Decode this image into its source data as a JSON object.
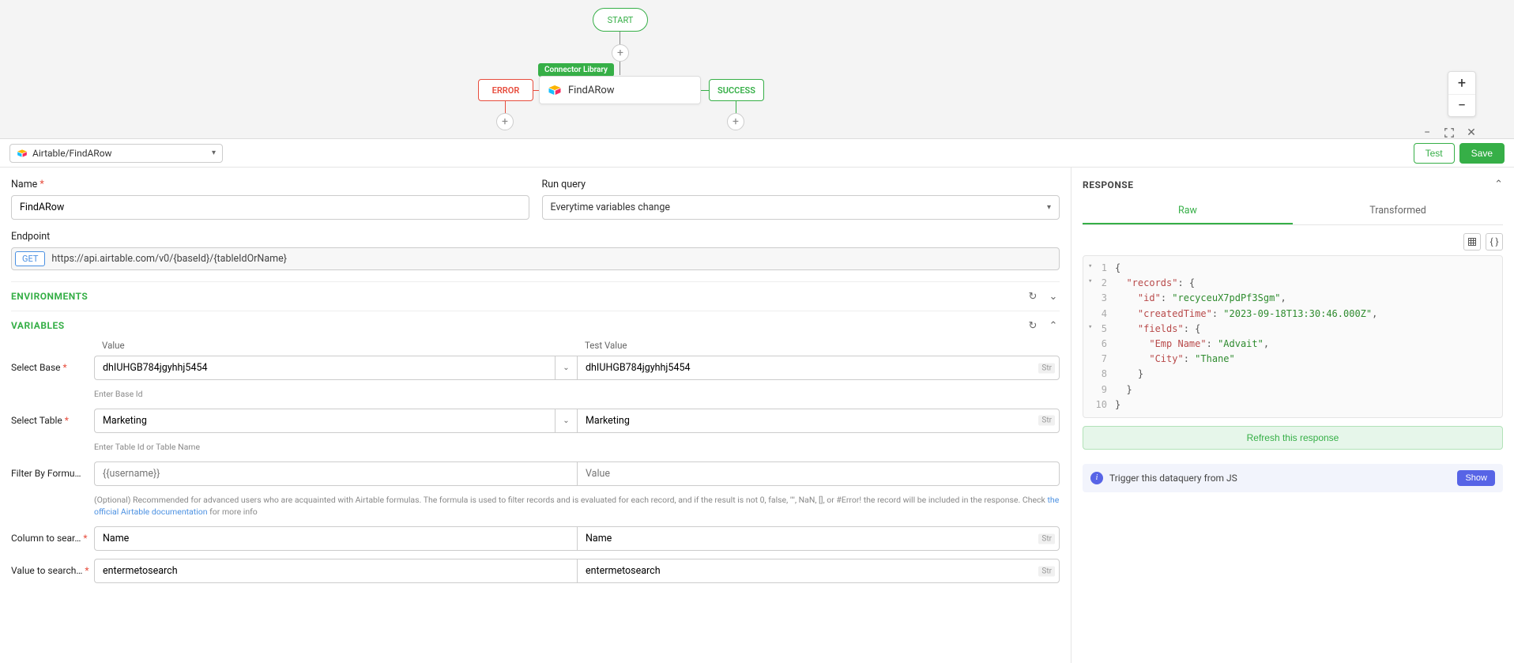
{
  "canvas": {
    "start_label": "START",
    "error_label": "ERROR",
    "success_label": "SUCCESS",
    "connector_tag": "Connector Library",
    "node_label": "FindARow"
  },
  "header": {
    "connector_selected": "Airtable/FindARow",
    "test_label": "Test",
    "save_label": "Save"
  },
  "form": {
    "name_label": "Name",
    "name_value": "FindARow",
    "run_query_label": "Run query",
    "run_query_value": "Everytime variables change",
    "endpoint_label": "Endpoint",
    "endpoint_method": "GET",
    "endpoint_url": "https://api.airtable.com/v0/{baseId}/{tableIdOrName}"
  },
  "sections": {
    "environments": "ENVIRONMENTS",
    "variables": "VARIABLES"
  },
  "variables": {
    "col_value": "Value",
    "col_test": "Test Value",
    "rows": [
      {
        "name_label": "Select Base",
        "required": true,
        "value": "dhIUHGB784jgyhhj5454",
        "test": "dhIUHGB784jgyhhj5454",
        "hasChevron": true,
        "typeBadge": "Str",
        "hint": "Enter Base Id"
      },
      {
        "name_label": "Select Table",
        "required": true,
        "value": "Marketing",
        "test": "Marketing",
        "hasChevron": true,
        "typeBadge": "Str",
        "hint": "Enter Table Id or Table Name"
      },
      {
        "name_label": "Filter By Formu…",
        "required": false,
        "value": "",
        "placeholder": "{{username}}",
        "test": "",
        "test_placeholder": "Value",
        "hasChevron": false,
        "hint_html": "(Optional) Recommended for advanced users who are acquainted with Airtable formulas. The formula is used to filter records and is evaluated for each record, and if the result is not 0, false, \"\", NaN, [], or #Error! the record will be included in the response. Check <a>the official Airtable documentation</a> for more info"
      },
      {
        "name_label": "Column to sear…",
        "required": true,
        "value": "Name",
        "test": "Name",
        "hasChevron": false,
        "typeBadge": "Str"
      },
      {
        "name_label": "Value to search…",
        "required": true,
        "value": "entermetosearch",
        "test": "entermetosearch",
        "hasChevron": false,
        "typeBadge": "Str"
      }
    ]
  },
  "response": {
    "title": "RESPONSE",
    "tab_raw": "Raw",
    "tab_transformed": "Transformed",
    "refresh_label": "Refresh this response",
    "info_text": "Trigger this dataquery from JS",
    "show_label": "Show",
    "json": {
      "records": {
        "id": "recyceuX7pdPf3Sgm",
        "createdTime": "2023-09-18T13:30:46.000Z",
        "fields": {
          "Emp Name": "Advait",
          "City": "Thane"
        }
      }
    },
    "lines": [
      {
        "n": 1,
        "fold": true,
        "k": "",
        "v": "{",
        "type": "punc"
      },
      {
        "n": 2,
        "fold": true,
        "indent": 1,
        "k": "records",
        "v": ": {",
        "type": "keyobj"
      },
      {
        "n": 3,
        "indent": 2,
        "k": "id",
        "v": "recyceuX7pdPf3Sgm",
        "type": "keystr",
        "comma": true
      },
      {
        "n": 4,
        "indent": 2,
        "k": "createdTime",
        "v": "2023-09-18T13:30:46.000Z",
        "type": "keystr",
        "comma": true
      },
      {
        "n": 5,
        "fold": true,
        "indent": 2,
        "k": "fields",
        "v": ": {",
        "type": "keyobj"
      },
      {
        "n": 6,
        "indent": 3,
        "k": "Emp Name",
        "v": "Advait",
        "type": "keystr",
        "comma": true
      },
      {
        "n": 7,
        "indent": 3,
        "k": "City",
        "v": "Thane",
        "type": "keystr"
      },
      {
        "n": 8,
        "indent": 2,
        "v": "}",
        "type": "punc"
      },
      {
        "n": 9,
        "indent": 1,
        "v": "}",
        "type": "punc"
      },
      {
        "n": 10,
        "indent": 0,
        "v": "}",
        "type": "punc"
      }
    ]
  }
}
